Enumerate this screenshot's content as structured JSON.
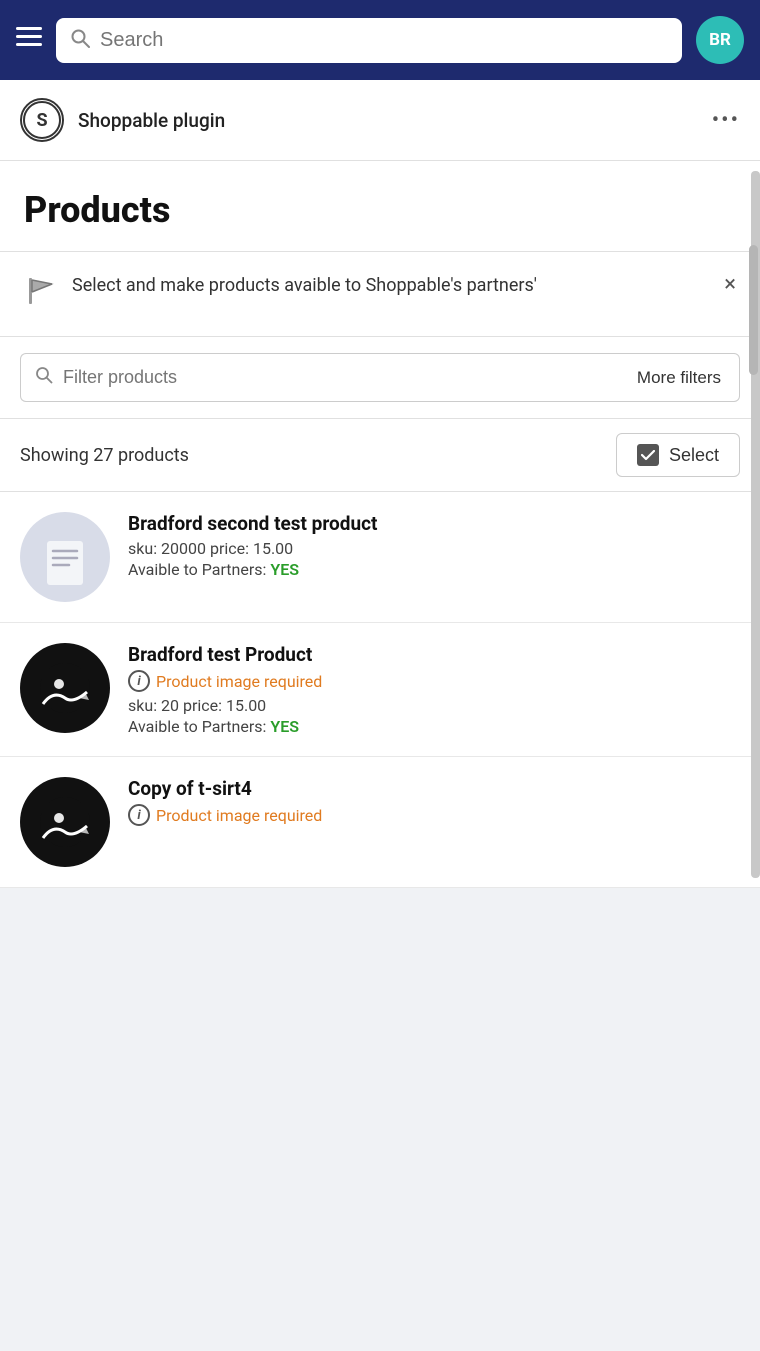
{
  "header": {
    "search_placeholder": "Search",
    "avatar_initials": "BR",
    "avatar_color": "#2dbdb6"
  },
  "plugin": {
    "logo_letter": "S",
    "title": "Shoppable plugin",
    "more_options_label": "•••"
  },
  "products_section": {
    "title": "Products"
  },
  "banner": {
    "text": "Select and make products avaible to Shoppable's partners'",
    "close_label": "×"
  },
  "filter": {
    "placeholder": "Filter products",
    "more_filters_label": "More filters"
  },
  "showing": {
    "text": "Showing 27 products",
    "select_label": "Select"
  },
  "products": [
    {
      "name": "Bradford second test product",
      "sku": "sku: 20000 price: 15.00",
      "partners_label": "Avaible to Partners:",
      "partners_value": "YES",
      "has_image": false,
      "has_warning": false,
      "warning_text": ""
    },
    {
      "name": "Bradford test Product",
      "sku": "sku: 20 price: 15.00",
      "partners_label": "Avaible to Partners:",
      "partners_value": "YES",
      "has_image": true,
      "has_warning": true,
      "warning_text": "Product image required"
    },
    {
      "name": "Copy of t-sirt4",
      "sku": "",
      "partners_label": "",
      "partners_value": "",
      "has_image": true,
      "has_warning": true,
      "warning_text": "Product image required"
    }
  ]
}
